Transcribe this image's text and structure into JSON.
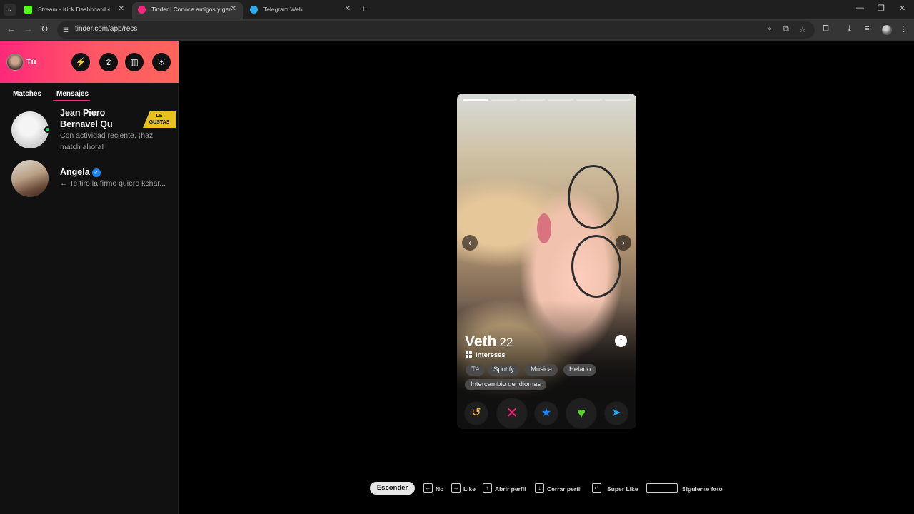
{
  "browser": {
    "tabs": [
      {
        "title": "Stream - Kick Dashboard",
        "favicon_color": "#53fc18"
      },
      {
        "title": "Tinder | Conoce amigos y gente",
        "favicon_color": "#fd267d"
      },
      {
        "title": "Telegram Web",
        "favicon_color": "#2aabee"
      }
    ],
    "url": "tinder.com/app/recs"
  },
  "sidebar": {
    "me_label": "Tú",
    "header_buttons": [
      "boost-icon",
      "explore-icon",
      "gift-icon",
      "shield-icon"
    ],
    "tabs": [
      {
        "label": "Matches"
      },
      {
        "label": "Mensajes"
      }
    ],
    "conversations": [
      {
        "name_line1": "Jean Piero",
        "name_line2": "Bernavel Qu",
        "preview_line1": "Con actividad reciente, ¡haz",
        "preview_line2": "match ahora!",
        "badge_line1": "LE",
        "badge_line2": "GUSTAS",
        "online": true
      },
      {
        "name": "Angela",
        "verified": true,
        "preview": "← Te tiro la firme quiero kchar..."
      }
    ]
  },
  "profile": {
    "name": "Veth",
    "age": "22",
    "interests_title": "Intereses",
    "interests": [
      "Té",
      "Spotify",
      "Música",
      "Helado",
      "Intercambio de idiomas"
    ],
    "photo_count": 6,
    "current_photo": 1,
    "actions": [
      {
        "name": "rewind",
        "glyph": "↺",
        "color": "#ffb340"
      },
      {
        "name": "nope",
        "glyph": "✕",
        "color": "#fd267d"
      },
      {
        "name": "super-like",
        "glyph": "★",
        "color": "#1786ff"
      },
      {
        "name": "like",
        "glyph": "♥",
        "color": "#5cd62e"
      },
      {
        "name": "boost",
        "glyph": "➤",
        "color": "#1eaaf1"
      }
    ]
  },
  "shortcuts": {
    "hide_label": "Esconder",
    "items": [
      {
        "key": "←",
        "label": "No"
      },
      {
        "key": "→",
        "label": "Like"
      },
      {
        "key": "↑",
        "label": "Abrir perfil"
      },
      {
        "key": "↓",
        "label": "Cerrar perfil"
      },
      {
        "key": "↵",
        "label": "Super Like"
      },
      {
        "key": "",
        "label": "Siguiente foto"
      }
    ]
  }
}
